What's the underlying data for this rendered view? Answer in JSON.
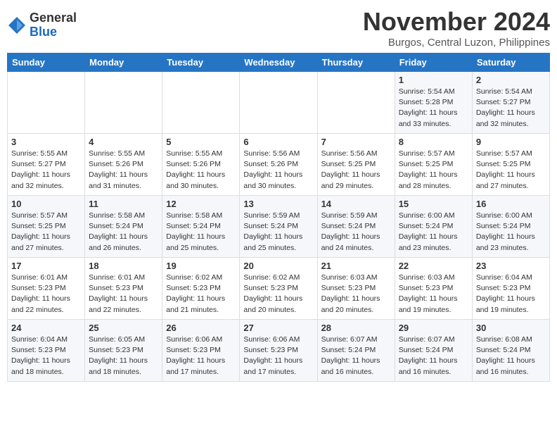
{
  "header": {
    "logo_general": "General",
    "logo_blue": "Blue",
    "month_title": "November 2024",
    "location": "Burgos, Central Luzon, Philippines"
  },
  "weekdays": [
    "Sunday",
    "Monday",
    "Tuesday",
    "Wednesday",
    "Thursday",
    "Friday",
    "Saturday"
  ],
  "weeks": [
    [
      {
        "day": "",
        "info": ""
      },
      {
        "day": "",
        "info": ""
      },
      {
        "day": "",
        "info": ""
      },
      {
        "day": "",
        "info": ""
      },
      {
        "day": "",
        "info": ""
      },
      {
        "day": "1",
        "info": "Sunrise: 5:54 AM\nSunset: 5:28 PM\nDaylight: 11 hours\nand 33 minutes."
      },
      {
        "day": "2",
        "info": "Sunrise: 5:54 AM\nSunset: 5:27 PM\nDaylight: 11 hours\nand 32 minutes."
      }
    ],
    [
      {
        "day": "3",
        "info": "Sunrise: 5:55 AM\nSunset: 5:27 PM\nDaylight: 11 hours\nand 32 minutes."
      },
      {
        "day": "4",
        "info": "Sunrise: 5:55 AM\nSunset: 5:26 PM\nDaylight: 11 hours\nand 31 minutes."
      },
      {
        "day": "5",
        "info": "Sunrise: 5:55 AM\nSunset: 5:26 PM\nDaylight: 11 hours\nand 30 minutes."
      },
      {
        "day": "6",
        "info": "Sunrise: 5:56 AM\nSunset: 5:26 PM\nDaylight: 11 hours\nand 30 minutes."
      },
      {
        "day": "7",
        "info": "Sunrise: 5:56 AM\nSunset: 5:25 PM\nDaylight: 11 hours\nand 29 minutes."
      },
      {
        "day": "8",
        "info": "Sunrise: 5:57 AM\nSunset: 5:25 PM\nDaylight: 11 hours\nand 28 minutes."
      },
      {
        "day": "9",
        "info": "Sunrise: 5:57 AM\nSunset: 5:25 PM\nDaylight: 11 hours\nand 27 minutes."
      }
    ],
    [
      {
        "day": "10",
        "info": "Sunrise: 5:57 AM\nSunset: 5:25 PM\nDaylight: 11 hours\nand 27 minutes."
      },
      {
        "day": "11",
        "info": "Sunrise: 5:58 AM\nSunset: 5:24 PM\nDaylight: 11 hours\nand 26 minutes."
      },
      {
        "day": "12",
        "info": "Sunrise: 5:58 AM\nSunset: 5:24 PM\nDaylight: 11 hours\nand 25 minutes."
      },
      {
        "day": "13",
        "info": "Sunrise: 5:59 AM\nSunset: 5:24 PM\nDaylight: 11 hours\nand 25 minutes."
      },
      {
        "day": "14",
        "info": "Sunrise: 5:59 AM\nSunset: 5:24 PM\nDaylight: 11 hours\nand 24 minutes."
      },
      {
        "day": "15",
        "info": "Sunrise: 6:00 AM\nSunset: 5:24 PM\nDaylight: 11 hours\nand 23 minutes."
      },
      {
        "day": "16",
        "info": "Sunrise: 6:00 AM\nSunset: 5:24 PM\nDaylight: 11 hours\nand 23 minutes."
      }
    ],
    [
      {
        "day": "17",
        "info": "Sunrise: 6:01 AM\nSunset: 5:23 PM\nDaylight: 11 hours\nand 22 minutes."
      },
      {
        "day": "18",
        "info": "Sunrise: 6:01 AM\nSunset: 5:23 PM\nDaylight: 11 hours\nand 22 minutes."
      },
      {
        "day": "19",
        "info": "Sunrise: 6:02 AM\nSunset: 5:23 PM\nDaylight: 11 hours\nand 21 minutes."
      },
      {
        "day": "20",
        "info": "Sunrise: 6:02 AM\nSunset: 5:23 PM\nDaylight: 11 hours\nand 20 minutes."
      },
      {
        "day": "21",
        "info": "Sunrise: 6:03 AM\nSunset: 5:23 PM\nDaylight: 11 hours\nand 20 minutes."
      },
      {
        "day": "22",
        "info": "Sunrise: 6:03 AM\nSunset: 5:23 PM\nDaylight: 11 hours\nand 19 minutes."
      },
      {
        "day": "23",
        "info": "Sunrise: 6:04 AM\nSunset: 5:23 PM\nDaylight: 11 hours\nand 19 minutes."
      }
    ],
    [
      {
        "day": "24",
        "info": "Sunrise: 6:04 AM\nSunset: 5:23 PM\nDaylight: 11 hours\nand 18 minutes."
      },
      {
        "day": "25",
        "info": "Sunrise: 6:05 AM\nSunset: 5:23 PM\nDaylight: 11 hours\nand 18 minutes."
      },
      {
        "day": "26",
        "info": "Sunrise: 6:06 AM\nSunset: 5:23 PM\nDaylight: 11 hours\nand 17 minutes."
      },
      {
        "day": "27",
        "info": "Sunrise: 6:06 AM\nSunset: 5:23 PM\nDaylight: 11 hours\nand 17 minutes."
      },
      {
        "day": "28",
        "info": "Sunrise: 6:07 AM\nSunset: 5:24 PM\nDaylight: 11 hours\nand 16 minutes."
      },
      {
        "day": "29",
        "info": "Sunrise: 6:07 AM\nSunset: 5:24 PM\nDaylight: 11 hours\nand 16 minutes."
      },
      {
        "day": "30",
        "info": "Sunrise: 6:08 AM\nSunset: 5:24 PM\nDaylight: 11 hours\nand 16 minutes."
      }
    ]
  ]
}
